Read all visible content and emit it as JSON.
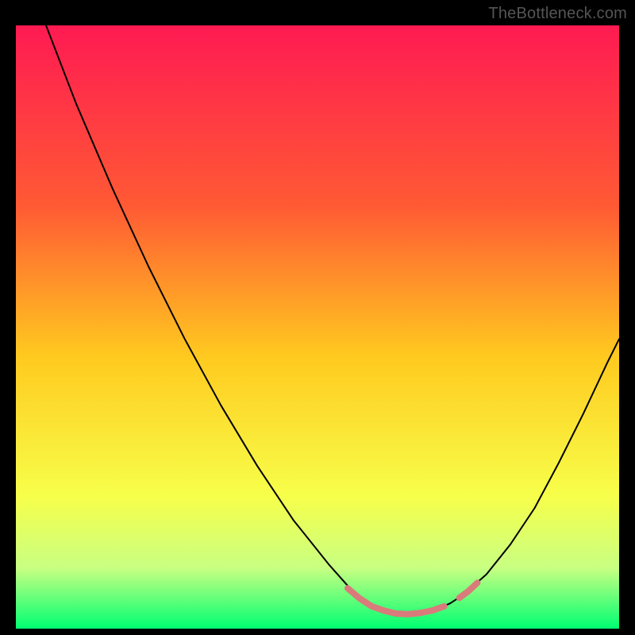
{
  "attribution": "TheBottleneck.com",
  "chart_data": {
    "type": "line",
    "title": "",
    "xlabel": "",
    "ylabel": "",
    "xlim": [
      0,
      100
    ],
    "ylim": [
      0,
      100
    ],
    "gradient_stops": [
      {
        "offset": 0.0,
        "color": "#ff1a52"
      },
      {
        "offset": 0.3,
        "color": "#ff5a34"
      },
      {
        "offset": 0.55,
        "color": "#ffca1f"
      },
      {
        "offset": 0.78,
        "color": "#f7ff4a"
      },
      {
        "offset": 0.9,
        "color": "#c8ff82"
      },
      {
        "offset": 1.0,
        "color": "#00ff72"
      }
    ],
    "series": [
      {
        "name": "main-curve",
        "color": "#000000",
        "stroke_width": 2,
        "points": [
          {
            "x": 5.0,
            "y": 100.0
          },
          {
            "x": 10.0,
            "y": 87.0
          },
          {
            "x": 16.0,
            "y": 73.0
          },
          {
            "x": 22.0,
            "y": 60.0
          },
          {
            "x": 28.0,
            "y": 48.0
          },
          {
            "x": 34.0,
            "y": 37.0
          },
          {
            "x": 40.0,
            "y": 27.0
          },
          {
            "x": 46.0,
            "y": 18.0
          },
          {
            "x": 52.0,
            "y": 10.5
          },
          {
            "x": 56.0,
            "y": 6.0
          },
          {
            "x": 58.0,
            "y": 4.3
          },
          {
            "x": 60.0,
            "y": 3.3
          },
          {
            "x": 62.0,
            "y": 2.7
          },
          {
            "x": 65.0,
            "y": 2.4
          },
          {
            "x": 68.0,
            "y": 2.7
          },
          {
            "x": 70.0,
            "y": 3.3
          },
          {
            "x": 72.0,
            "y": 4.2
          },
          {
            "x": 74.0,
            "y": 5.5
          },
          {
            "x": 78.0,
            "y": 9.0
          },
          {
            "x": 82.0,
            "y": 14.0
          },
          {
            "x": 86.0,
            "y": 20.0
          },
          {
            "x": 90.0,
            "y": 27.5
          },
          {
            "x": 94.0,
            "y": 35.5
          },
          {
            "x": 98.0,
            "y": 44.0
          },
          {
            "x": 100.0,
            "y": 48.0
          }
        ]
      },
      {
        "name": "highlight-left",
        "color": "#d97b7b",
        "stroke_width": 8,
        "points": [
          {
            "x": 55.0,
            "y": 6.7
          },
          {
            "x": 57.0,
            "y": 5.0
          },
          {
            "x": 59.0,
            "y": 3.7
          },
          {
            "x": 61.0,
            "y": 3.0
          },
          {
            "x": 63.0,
            "y": 2.5
          },
          {
            "x": 65.0,
            "y": 2.4
          },
          {
            "x": 67.0,
            "y": 2.6
          },
          {
            "x": 69.0,
            "y": 3.0
          },
          {
            "x": 71.0,
            "y": 3.7
          }
        ]
      },
      {
        "name": "highlight-right",
        "color": "#d97b7b",
        "stroke_width": 8,
        "points": [
          {
            "x": 73.5,
            "y": 5.1
          },
          {
            "x": 75.0,
            "y": 6.2
          },
          {
            "x": 76.5,
            "y": 7.6
          }
        ]
      }
    ]
  }
}
